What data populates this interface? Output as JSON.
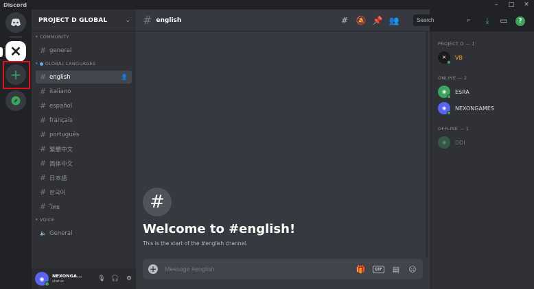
{
  "window": {
    "title": "Discord",
    "controls": [
      "–",
      "□",
      "✕"
    ]
  },
  "server_rail": {
    "home_icon": "discord-home-icon",
    "project_badge": "✕",
    "add_server_symbol": "+",
    "explore_icon": "compass-icon"
  },
  "guild": {
    "name": "PROJECT D GLOBAL",
    "chevron": "⌄"
  },
  "categories": [
    {
      "label": "COMMUNITY",
      "channels": [
        "general"
      ]
    },
    {
      "label": "GLOBAL LANGUAGES",
      "channels": [
        "english",
        "italiano",
        "español",
        "français",
        "português",
        "繁體中文",
        "简体中文",
        "日本語",
        "한국어",
        "ไทย"
      ]
    },
    {
      "label": "VOICE",
      "channels": [
        "General"
      ]
    }
  ],
  "user_panel": {
    "name": "NEXONGA...",
    "tag": "status"
  },
  "channel_header": {
    "name": "english"
  },
  "search": {
    "placeholder": "Search"
  },
  "welcome": {
    "hash": "#",
    "title": "Welcome to #english!",
    "subtitle": "This is the start of the #english channel."
  },
  "composer": {
    "plus": "+",
    "placeholder": "Message #english",
    "gif_label": "GIF"
  },
  "members": {
    "groups": [
      {
        "label": "PROJECT D — 1",
        "members": [
          {
            "name": "VB",
            "color": "#faa61a"
          }
        ]
      },
      {
        "label": "ONLINE — 2",
        "members": [
          {
            "name": "ESRA",
            "color": "#3ba55d"
          },
          {
            "name": "NEXONGAMES",
            "color": "#5865f2"
          }
        ]
      },
      {
        "label": "OFFLINE — 1",
        "members": [
          {
            "name": "DDI",
            "color": "#3ba55d"
          }
        ]
      }
    ]
  },
  "colors": {
    "accent": "#5865f2",
    "online": "#3ba55d",
    "highlight_box": "#e0121a"
  }
}
